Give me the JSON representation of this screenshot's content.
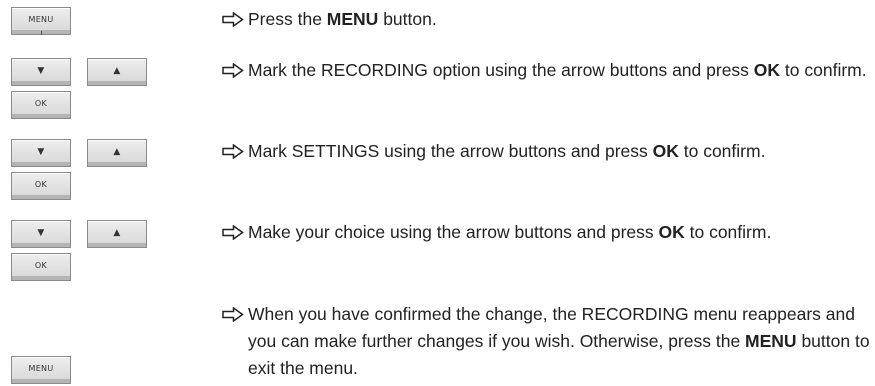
{
  "buttons": {
    "menu": "MENU",
    "down": "▼",
    "up": "▲",
    "ok": "OK"
  },
  "steps": [
    {
      "pre": "Press the ",
      "bold": "MENU",
      "post": " button."
    },
    {
      "pre": "Mark the RECORDING option using the arrow buttons and press ",
      "bold": "OK",
      "post": " to confirm."
    },
    {
      "pre": "Mark SETTINGS using the arrow buttons and press ",
      "bold": "OK",
      "post": " to confirm."
    },
    {
      "pre": "Make your choice using the arrow buttons and press ",
      "bold": "OK",
      "post": " to confirm."
    },
    {
      "pre": "When you have confirmed the change, the RECORDING menu reappears and you can make further changes if you wish. Otherwise, press the ",
      "bold": "MENU",
      "post": " button to exit the menu."
    }
  ],
  "icons": {
    "step_marker": "right-arrow-icon"
  }
}
